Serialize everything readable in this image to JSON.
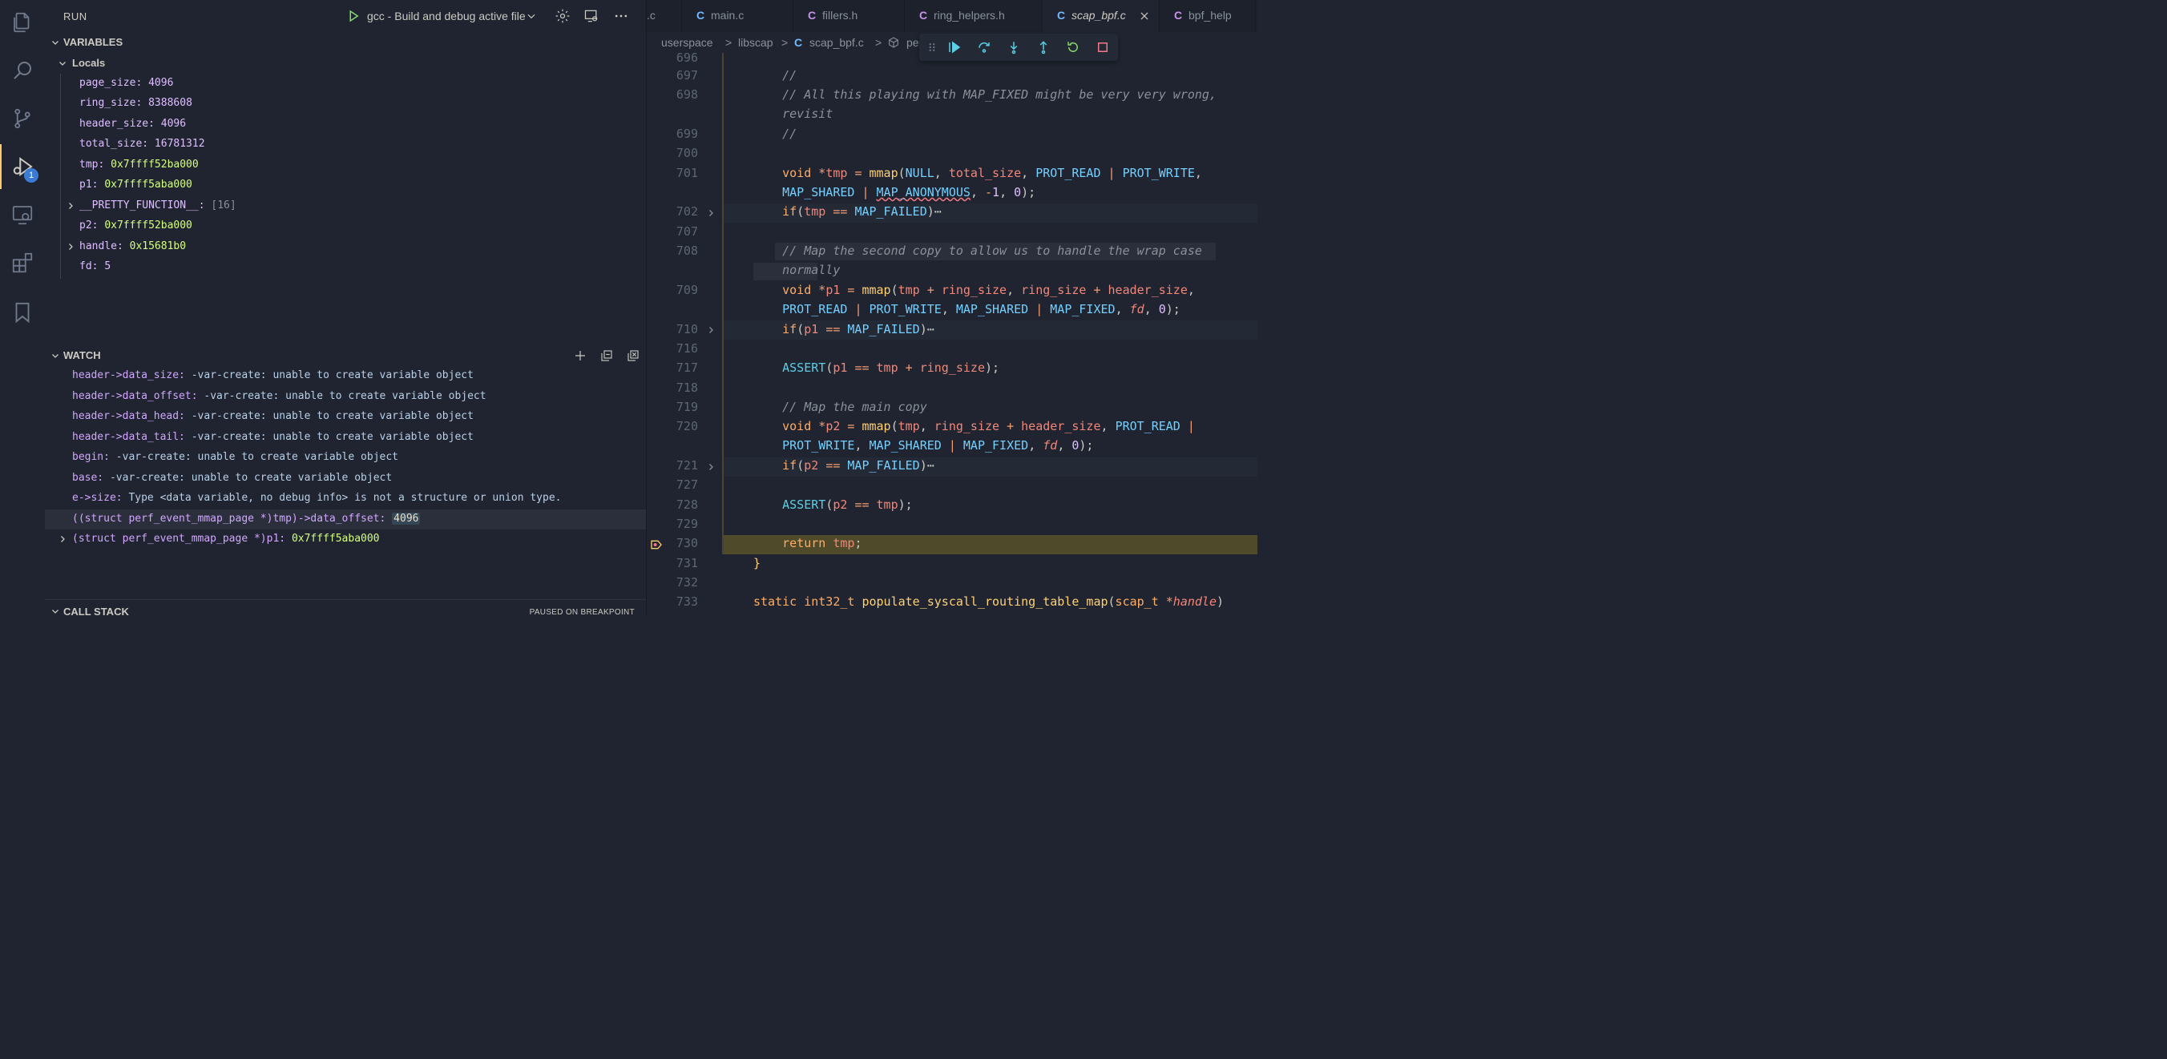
{
  "activity_bar": {
    "items": [
      "explorer-icon",
      "search-icon",
      "source-control-icon",
      "run-debug-icon",
      "remote-explorer-icon",
      "extensions-icon",
      "bookmarks-icon"
    ],
    "debug_badge": "1"
  },
  "run_panel": {
    "title": "RUN",
    "launch_config": "gcc - Build and debug active file"
  },
  "variables": {
    "header": "VARIABLES",
    "locals_label": "Locals",
    "items": [
      {
        "name": "page_size:",
        "value": "4096"
      },
      {
        "name": "ring_size:",
        "value": "8388608"
      },
      {
        "name": "header_size:",
        "value": "4096"
      },
      {
        "name": "total_size:",
        "value": "16781312"
      },
      {
        "name": "tmp:",
        "value": "0x7ffff52ba000"
      },
      {
        "name": "p1:",
        "value": "0x7ffff5aba000"
      },
      {
        "name": "__PRETTY_FUNCTION__:",
        "value": "[16]"
      },
      {
        "name": "p2:",
        "value": "0x7ffff52ba000"
      },
      {
        "name": "handle:",
        "value": "0x15681b0"
      },
      {
        "name": "fd:",
        "value": "5"
      }
    ]
  },
  "watch": {
    "header": "WATCH",
    "items": [
      {
        "expr": "header->data_size:",
        "value": "-var-create: unable to create variable object"
      },
      {
        "expr": "header->data_offset:",
        "value": "-var-create: unable to create variable object"
      },
      {
        "expr": "header->data_head:",
        "value": "-var-create: unable to create variable object"
      },
      {
        "expr": "header->data_tail:",
        "value": "-var-create: unable to create variable object"
      },
      {
        "expr": "begin:",
        "value": "-var-create: unable to create variable object"
      },
      {
        "expr": "base:",
        "value": "-var-create: unable to create variable object"
      },
      {
        "expr": "e->size:",
        "value": "Type <data variable, no debug info> is not a structure or union type."
      },
      {
        "expr": "((struct perf_event_mmap_page *)tmp)->data_offset:",
        "value": "4096"
      },
      {
        "expr": "(struct perf_event_mmap_page *)p1:",
        "value": "0x7ffff5aba000"
      }
    ]
  },
  "call_stack": {
    "header": "CALL STACK",
    "status": "PAUSED ON BREAKPOINT"
  },
  "tabs": [
    {
      "label": ".c"
    },
    {
      "label": "main.c"
    },
    {
      "label": "fillers.h"
    },
    {
      "label": "ring_helpers.h"
    },
    {
      "label": "scap_bpf.c"
    },
    {
      "label": "bpf_help"
    }
  ],
  "tab_icon_letter": "C",
  "breadcrumb": {
    "parts": [
      "userspace",
      "libscap",
      "scap_bpf.c",
      "pe"
    ],
    "separator": ">"
  },
  "code": {
    "line_numbers": [
      "696",
      "697",
      "698",
      "",
      "699",
      "700",
      "701",
      "",
      "702",
      "707",
      "708",
      "",
      "709",
      "",
      "710",
      "716",
      "717",
      "718",
      "719",
      "720",
      "",
      "721",
      "727",
      "728",
      "729",
      "730",
      "731",
      "732",
      "733"
    ],
    "collapsed_ellipsis": "⋯"
  },
  "colors": {
    "background": "#1f2430",
    "accent": "#ffcc66",
    "breakpoint_line": "#4f4a2a"
  }
}
